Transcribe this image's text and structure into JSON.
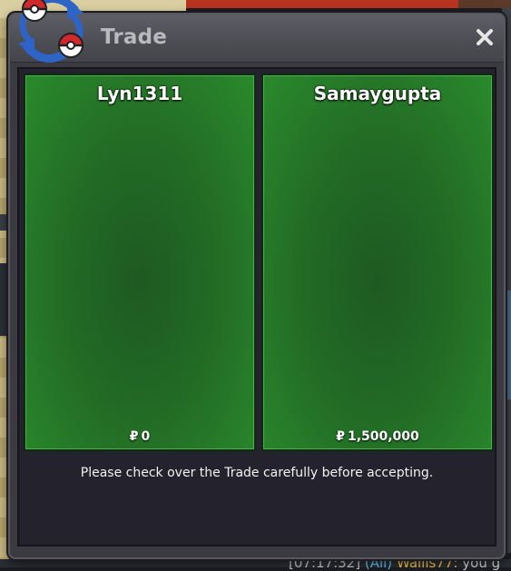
{
  "window": {
    "title": "Trade",
    "close_icon": "close-x-icon",
    "logo_icon": "pokeball-swap-icon"
  },
  "offers": [
    {
      "player": "Lyn1311",
      "currency_symbol": "₽",
      "money": "0"
    },
    {
      "player": "Samaygupta",
      "currency_symbol": "₽",
      "money": "1,500,000"
    }
  ],
  "notice": "Please check over the Trade carefully before accepting.",
  "chat": {
    "timestamp": "[07:17:32]",
    "channel": "(All)",
    "user": "Wallis77:",
    "message": "you g"
  },
  "colors": {
    "panel_green": "#226a25",
    "window_bg": "#3a3a40",
    "content_bg": "#24232d",
    "title_text": "#b9b9bd"
  }
}
